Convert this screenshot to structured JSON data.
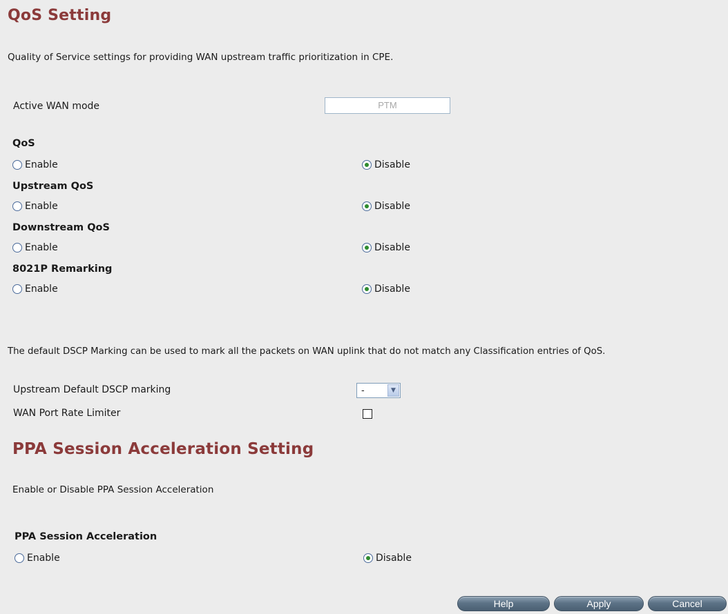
{
  "qos": {
    "title": "QoS Setting",
    "description": "Quality of Service settings for providing WAN upstream traffic prioritization in CPE.",
    "active_wan_mode_label": "Active WAN mode",
    "active_wan_mode_value": "PTM",
    "groups": [
      {
        "label": "QoS",
        "enable": "Enable",
        "disable": "Disable",
        "selected": "Disable"
      },
      {
        "label": "Upstream QoS",
        "enable": "Enable",
        "disable": "Disable",
        "selected": "Disable"
      },
      {
        "label": "Downstream QoS",
        "enable": "Enable",
        "disable": "Disable",
        "selected": "Disable"
      },
      {
        "label": "8021P Remarking",
        "enable": "Enable",
        "disable": "Disable",
        "selected": "Disable"
      }
    ],
    "dscp_description": "The default DSCP Marking can be used to mark all the packets on WAN uplink that do not match any Classification entries of QoS.",
    "dscp_label": "Upstream Default DSCP marking",
    "dscp_value": "-",
    "rate_limiter_label": "WAN Port Rate Limiter",
    "rate_limiter_checked": false
  },
  "ppa": {
    "title": "PPA Session Acceleration Setting",
    "description": "Enable or Disable PPA Session Acceleration",
    "group_label": "PPA Session Acceleration",
    "enable": "Enable",
    "disable": "Disable",
    "selected": "Disable"
  },
  "buttons": {
    "help": "Help",
    "apply": "Apply",
    "cancel": "Cancel"
  },
  "colors": {
    "title": "#8b3a3a",
    "background": "#ececec",
    "radio_selected": "#2e8b2e"
  }
}
